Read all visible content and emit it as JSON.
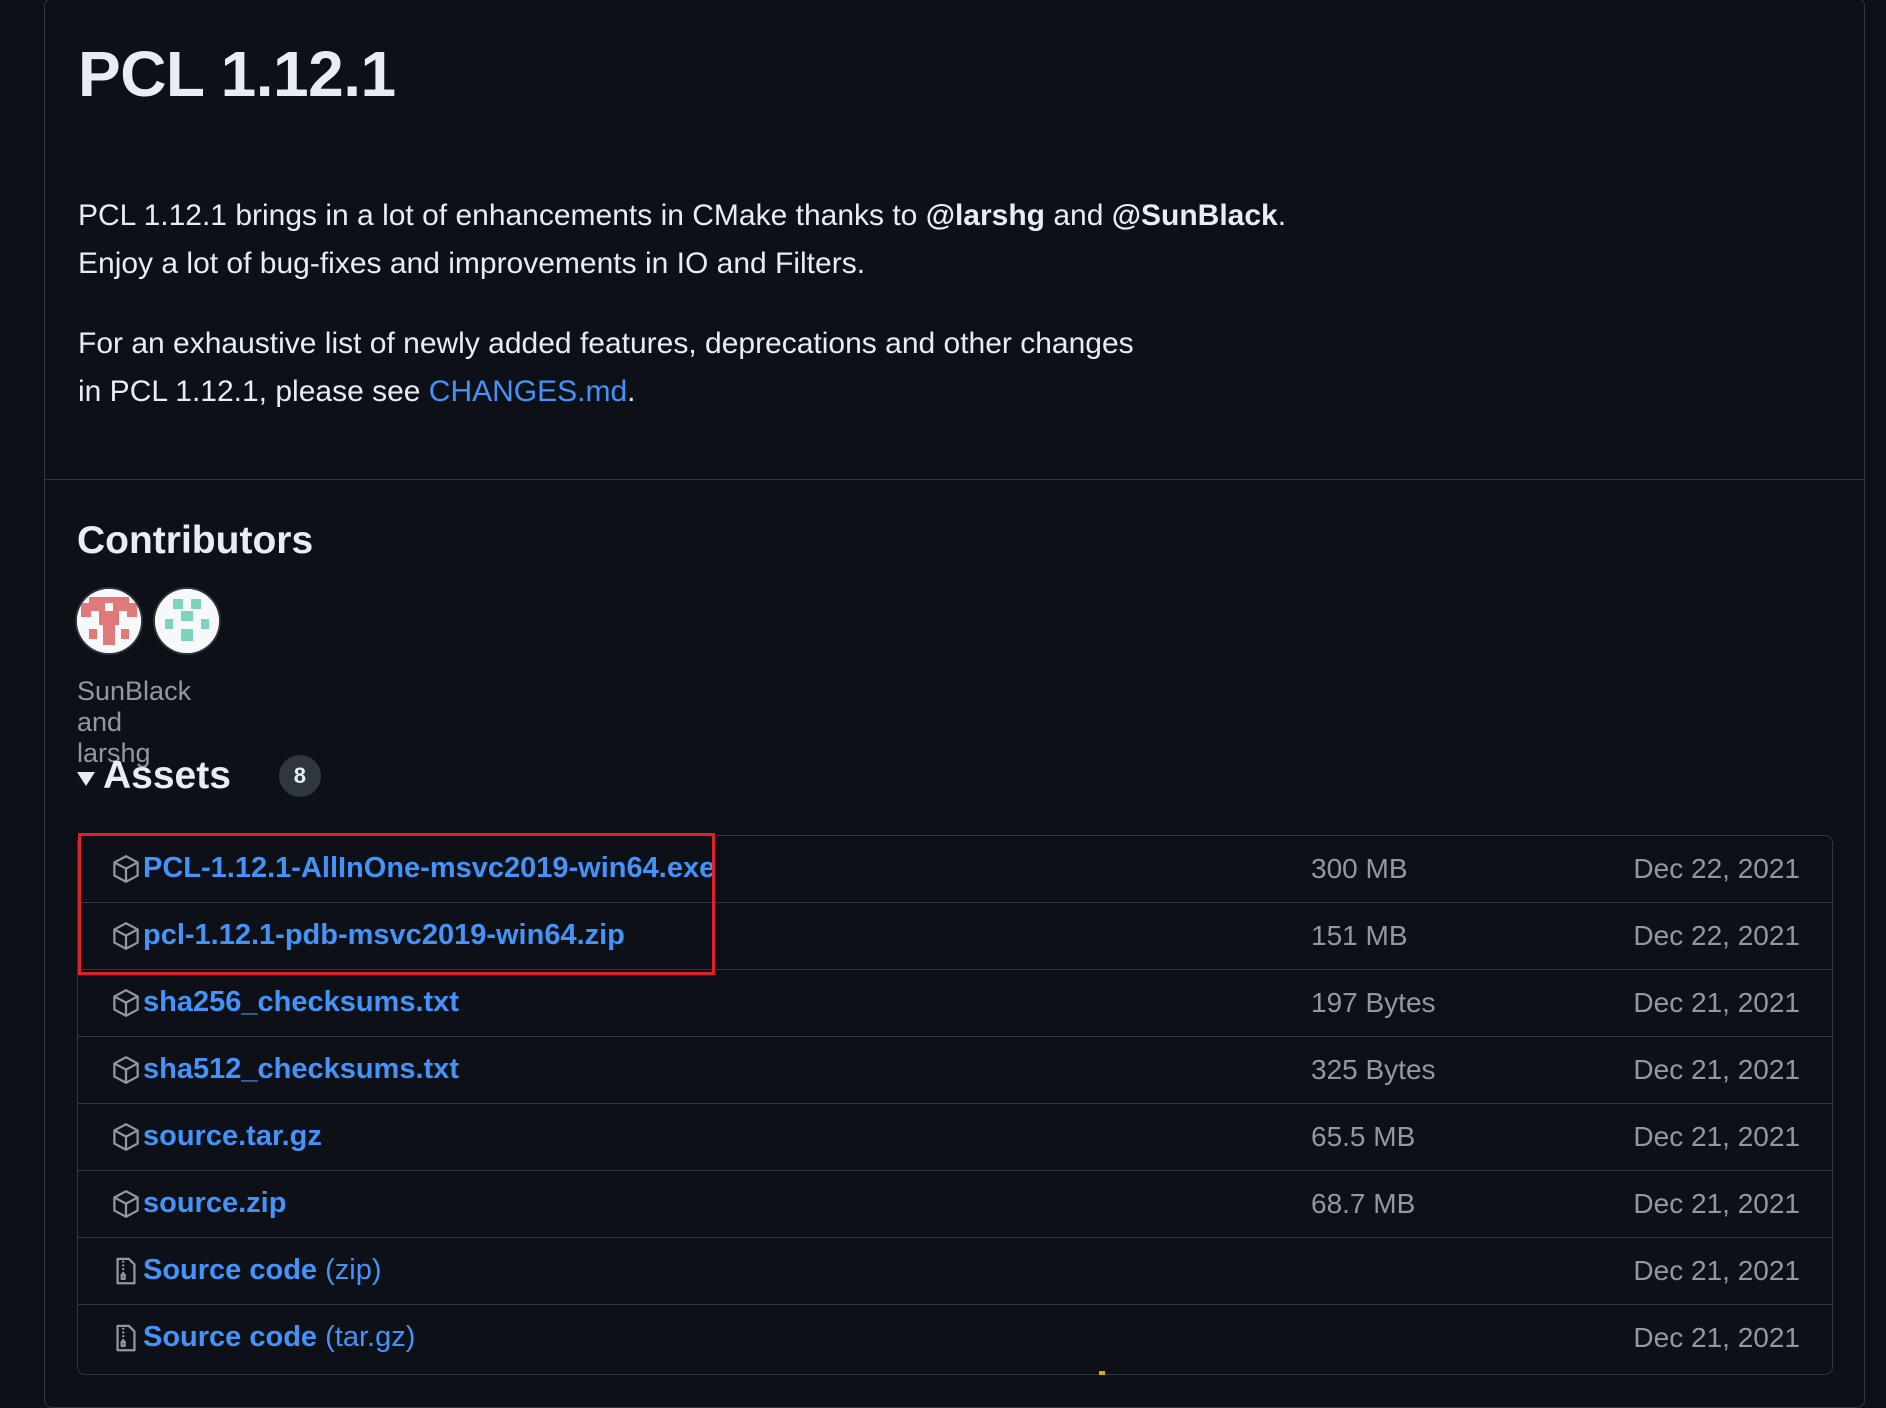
{
  "release": {
    "title": "PCL 1.12.1",
    "intro": {
      "text1": "PCL 1.12.1 brings in a lot of enhancements in CMake thanks to ",
      "mention1": "@larshg",
      "text2": " and ",
      "mention2": "@SunBlack",
      "text3": ".",
      "line2": "Enjoy a lot of bug-fixes and improvements in IO and Filters."
    },
    "changes": {
      "line1": "For an exhaustive list of newly added features, deprecations and other changes",
      "line2_prefix": "in PCL 1.12.1, please see ",
      "link": "CHANGES.md",
      "line2_suffix": "."
    }
  },
  "contributors": {
    "title": "Contributors",
    "names": "SunBlack and larshg",
    "avatars": [
      {
        "icon": "identicon-avatar",
        "color": "#e07a7a"
      },
      {
        "icon": "identicon-avatar",
        "color": "#7dd3c0"
      }
    ]
  },
  "assets": {
    "title": "Assets",
    "count": "8",
    "items": [
      {
        "name": "PCL-1.12.1-AllInOne-msvc2019-win64.exe",
        "suffix": "",
        "size": "300 MB",
        "date": "Dec 22, 2021",
        "icon": "package-icon"
      },
      {
        "name": "pcl-1.12.1-pdb-msvc2019-win64.zip",
        "suffix": "",
        "size": "151 MB",
        "date": "Dec 22, 2021",
        "icon": "package-icon"
      },
      {
        "name": "sha256_checksums.txt",
        "suffix": "",
        "size": "197 Bytes",
        "date": "Dec 21, 2021",
        "icon": "package-icon"
      },
      {
        "name": "sha512_checksums.txt",
        "suffix": "",
        "size": "325 Bytes",
        "date": "Dec 21, 2021",
        "icon": "package-icon"
      },
      {
        "name": "source.tar.gz",
        "suffix": "",
        "size": "65.5 MB",
        "date": "Dec 21, 2021",
        "icon": "package-icon"
      },
      {
        "name": "source.zip",
        "suffix": "",
        "size": "68.7 MB",
        "date": "Dec 21, 2021",
        "icon": "package-icon"
      },
      {
        "name": "Source code",
        "suffix": " (zip)",
        "size": "",
        "date": "Dec 21, 2021",
        "icon": "file-zip-icon"
      },
      {
        "name": "Source code",
        "suffix": " (tar.gz)",
        "size": "",
        "date": "Dec 21, 2021",
        "icon": "file-zip-icon"
      }
    ]
  },
  "colors": {
    "background": "#0d1117",
    "border": "#30363d",
    "link": "#4493f8",
    "muted": "#9198a1",
    "highlight": "#e0202a"
  }
}
